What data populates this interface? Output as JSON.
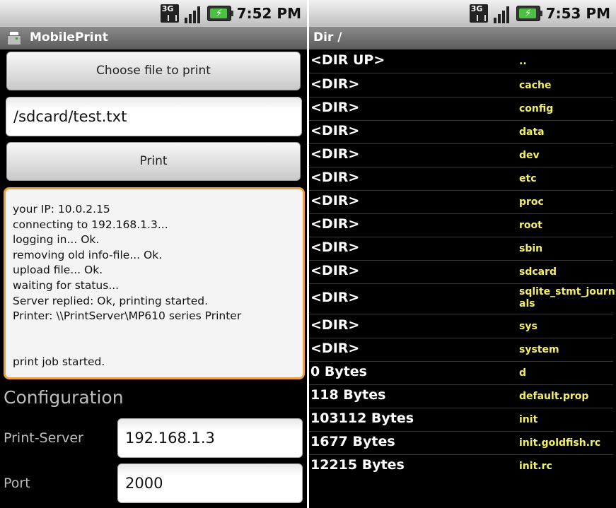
{
  "left": {
    "status": {
      "time": "7:52 PM",
      "network": "3G"
    },
    "app_title": "MobilePrint",
    "choose_button": "Choose file to print",
    "file_path": "/sdcard/test.txt",
    "print_button": "Print",
    "log_lines": [
      "your IP: 10.0.2.15",
      "connecting to 192.168.1.3...",
      "logging in... Ok.",
      "removing old info-file... Ok.",
      "upload file... Ok.",
      "waiting for status...",
      "Server replied: Ok, printing started.",
      "Printer: \\\\PrintServer\\MP610 series Printer",
      "",
      "",
      "print job started."
    ],
    "config": {
      "title": "Configuration",
      "server_label": "Print-Server",
      "server_value": "192.168.1.3",
      "port_label": "Port",
      "port_value": "2000"
    }
  },
  "right": {
    "status": {
      "time": "7:53 PM",
      "network": "3G"
    },
    "title": "Dir /",
    "entries": [
      {
        "type": "<DIR UP>",
        "name": ".."
      },
      {
        "type": "<DIR>",
        "name": "cache"
      },
      {
        "type": "<DIR>",
        "name": "config"
      },
      {
        "type": "<DIR>",
        "name": "data"
      },
      {
        "type": "<DIR>",
        "name": "dev"
      },
      {
        "type": "<DIR>",
        "name": "etc"
      },
      {
        "type": "<DIR>",
        "name": "proc"
      },
      {
        "type": "<DIR>",
        "name": "root"
      },
      {
        "type": "<DIR>",
        "name": "sbin"
      },
      {
        "type": "<DIR>",
        "name": "sdcard"
      },
      {
        "type": "<DIR>",
        "name": "sqlite_stmt_journals"
      },
      {
        "type": "<DIR>",
        "name": "sys"
      },
      {
        "type": "<DIR>",
        "name": "system"
      },
      {
        "type": "0 Bytes",
        "name": "d"
      },
      {
        "type": "118 Bytes",
        "name": "default.prop"
      },
      {
        "type": "103112 Bytes",
        "name": "init"
      },
      {
        "type": "1677 Bytes",
        "name": "init.goldfish.rc"
      },
      {
        "type": "12215 Bytes",
        "name": "init.rc"
      }
    ]
  }
}
